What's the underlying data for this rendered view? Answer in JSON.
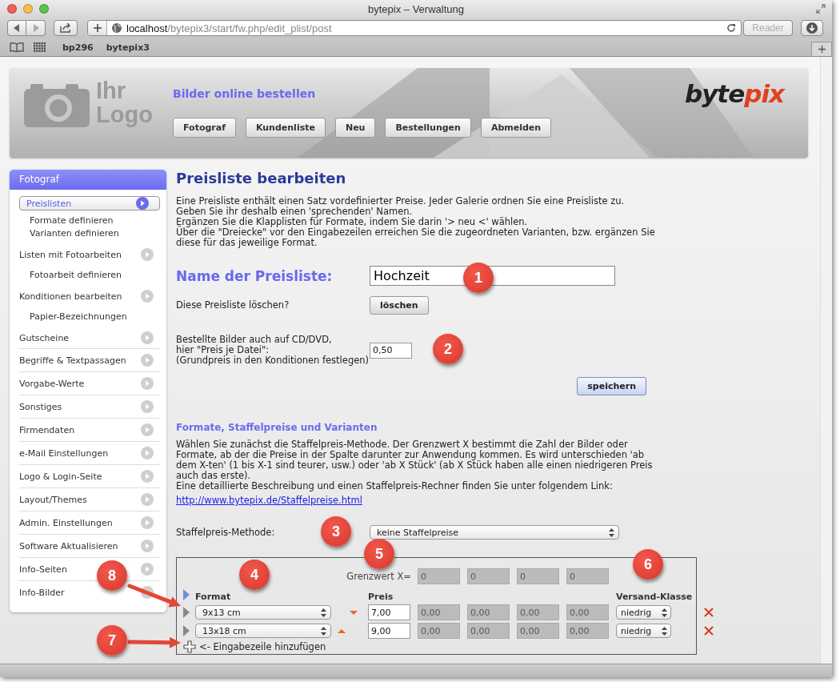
{
  "window": {
    "title": "bytepix – Verwaltung"
  },
  "toolbar": {
    "url_host": "localhost",
    "url_path": "/bytepix3/start/fw.php/edit_plist/post",
    "reader": "Reader",
    "reader_disabled": true
  },
  "bookmarks": [
    "bp296",
    "bytepix3"
  ],
  "header": {
    "logo_lines": [
      "Ihr",
      "Logo"
    ],
    "tagline": "Bilder online bestellen",
    "brand_left": "byte",
    "brand_right": "pix",
    "nav": [
      "Fotograf",
      "Kundenliste",
      "Neu",
      "Bestellungen",
      "Abmelden"
    ]
  },
  "sidebar": {
    "title": "Fotograf",
    "items": [
      {
        "label": "Preislisten",
        "selected": true,
        "children": [
          {
            "label": "Formate definieren",
            "selected": false
          },
          {
            "label": "Varianten definieren",
            "selected": false
          }
        ]
      },
      {
        "label": "Listen mit Fotoarbeiten",
        "selected": false,
        "children": [
          {
            "label": "Fotoarbeit definieren",
            "selected": false
          }
        ]
      },
      {
        "label": "Konditionen bearbeiten",
        "selected": false,
        "children": [
          {
            "label": "Papier-Bezeichnungen",
            "selected": false
          }
        ]
      },
      {
        "label": "Gutscheine",
        "selected": false
      },
      {
        "label": "Begriffe & Textpassagen",
        "selected": false
      },
      {
        "label": "Vorgabe-Werte",
        "selected": false
      },
      {
        "label": "Sonstiges",
        "selected": false
      },
      {
        "label": "Firmendaten",
        "selected": false
      },
      {
        "label": "e-Mail Einstellungen",
        "selected": false
      },
      {
        "label": "Logo & Login-Seite",
        "selected": false
      },
      {
        "label": "Layout/Themes",
        "selected": false
      },
      {
        "label": "Admin. Einstellungen",
        "selected": false
      },
      {
        "label": "Software Aktualisieren",
        "selected": false
      },
      {
        "label": "Info-Seiten",
        "selected": false
      },
      {
        "label": "Info-Bilder",
        "selected": false
      }
    ]
  },
  "main": {
    "title": "Preisliste bearbeiten",
    "intro": [
      "Eine Preisliste enthält einen Satz vordefinierter Preise. Jeder Galerie ordnen Sie eine Preisliste zu.",
      "Geben Sie ihr deshalb einen 'sprechenden' Namen.",
      "Ergänzen Sie die Klapplisten für Formate, indem Sie darin '> neu <' wählen.",
      "Über die \"Dreiecke\" vor den Eingabezeilen erreichen Sie die zugeordneten Varianten, bzw. ergänzen Sie diese für das jeweilige Format."
    ],
    "name_label": "Name der Preisliste:",
    "name_value": "Hochzeit",
    "delete_label": "Diese Preisliste löschen?",
    "delete_button": "löschen",
    "cd_label": "Bestellte Bilder auch auf CD/DVD,\nhier \"Preis je Datei\":\n(Grundpreis in den Konditionen festlegen)",
    "cd_value": "0,50",
    "save_button": "speichern",
    "section_title": "Formate, Staffelpreise und Varianten",
    "section_text": "Wählen Sie zunächst die Staffelpreis-Methode. Der Grenzwert X bestimmt die Zahl der Bilder oder Formate, ab der die Preise in der Spalte darunter zur Anwendung kommen. Es wird unterschieden 'ab dem X-ten' (1 bis X-1 sind teurer, usw.) oder 'ab X Stück' (ab X Stück haben alle einen niedrigeren Preis auch das erste).",
    "link_intro": "Eine detaillierte Beschreibung und einen Staffelpreis-Rechner finden Sie unter folgendem Link:",
    "link": "http://www.bytepix.de/Staffelpreise.html",
    "method_label": "Staffelpreis-Methode:",
    "method_value": "keine Staffelpreise"
  },
  "table": {
    "threshold_label": "Grenzwert X=",
    "thresholds": [
      "0",
      "0",
      "0",
      "0"
    ],
    "tiers_disabled": true,
    "col_format": "Format",
    "col_price": "Preis",
    "col_shipping": "Versand-Klasse",
    "rows": [
      {
        "format": "9x13 cm",
        "points_down": true,
        "price": "7,00",
        "tier_prices": [
          "0,00",
          "0,00",
          "0,00",
          "0,00"
        ],
        "shipping": "niedrig"
      },
      {
        "format": "13x18 cm",
        "points_down": false,
        "price": "9,00",
        "tier_prices": [
          "0,00",
          "0,00",
          "0,00",
          "0,00"
        ],
        "shipping": "niedrig"
      }
    ],
    "add_label": "<- Eingabezeile hinzufügen"
  },
  "callouts": [
    {
      "number": "1",
      "arrow": false
    },
    {
      "number": "2",
      "arrow": false
    },
    {
      "number": "3",
      "arrow": false
    },
    {
      "number": "4",
      "arrow": false
    },
    {
      "number": "5",
      "arrow": false
    },
    {
      "number": "6",
      "arrow": false
    },
    {
      "number": "7",
      "arrow": true
    },
    {
      "number": "8",
      "arrow": true
    }
  ]
}
